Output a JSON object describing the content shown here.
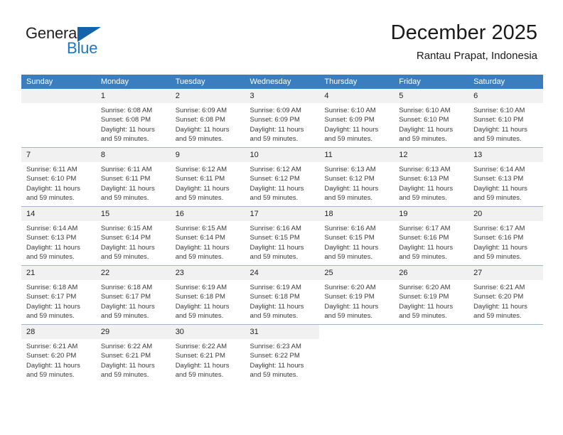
{
  "brand": {
    "name_part1": "General",
    "name_part2": "Blue",
    "accent_color": "#1b77c3",
    "triangle_color": "#1263ac",
    "triangle_icon": "triangle-right-icon"
  },
  "header": {
    "title": "December 2025",
    "subtitle": "Rantau Prapat, Indonesia"
  },
  "calendar": {
    "header_bg": "#3b7ebf",
    "daynum_bg": "#f1f1f1",
    "weekdays": [
      "Sunday",
      "Monday",
      "Tuesday",
      "Wednesday",
      "Thursday",
      "Friday",
      "Saturday"
    ],
    "weeks": [
      [
        {
          "day": "",
          "lines": []
        },
        {
          "day": "1",
          "lines": [
            "Sunrise: 6:08 AM",
            "Sunset: 6:08 PM",
            "Daylight: 11 hours",
            "and 59 minutes."
          ]
        },
        {
          "day": "2",
          "lines": [
            "Sunrise: 6:09 AM",
            "Sunset: 6:08 PM",
            "Daylight: 11 hours",
            "and 59 minutes."
          ]
        },
        {
          "day": "3",
          "lines": [
            "Sunrise: 6:09 AM",
            "Sunset: 6:09 PM",
            "Daylight: 11 hours",
            "and 59 minutes."
          ]
        },
        {
          "day": "4",
          "lines": [
            "Sunrise: 6:10 AM",
            "Sunset: 6:09 PM",
            "Daylight: 11 hours",
            "and 59 minutes."
          ]
        },
        {
          "day": "5",
          "lines": [
            "Sunrise: 6:10 AM",
            "Sunset: 6:10 PM",
            "Daylight: 11 hours",
            "and 59 minutes."
          ]
        },
        {
          "day": "6",
          "lines": [
            "Sunrise: 6:10 AM",
            "Sunset: 6:10 PM",
            "Daylight: 11 hours",
            "and 59 minutes."
          ]
        }
      ],
      [
        {
          "day": "7",
          "lines": [
            "Sunrise: 6:11 AM",
            "Sunset: 6:10 PM",
            "Daylight: 11 hours",
            "and 59 minutes."
          ]
        },
        {
          "day": "8",
          "lines": [
            "Sunrise: 6:11 AM",
            "Sunset: 6:11 PM",
            "Daylight: 11 hours",
            "and 59 minutes."
          ]
        },
        {
          "day": "9",
          "lines": [
            "Sunrise: 6:12 AM",
            "Sunset: 6:11 PM",
            "Daylight: 11 hours",
            "and 59 minutes."
          ]
        },
        {
          "day": "10",
          "lines": [
            "Sunrise: 6:12 AM",
            "Sunset: 6:12 PM",
            "Daylight: 11 hours",
            "and 59 minutes."
          ]
        },
        {
          "day": "11",
          "lines": [
            "Sunrise: 6:13 AM",
            "Sunset: 6:12 PM",
            "Daylight: 11 hours",
            "and 59 minutes."
          ]
        },
        {
          "day": "12",
          "lines": [
            "Sunrise: 6:13 AM",
            "Sunset: 6:13 PM",
            "Daylight: 11 hours",
            "and 59 minutes."
          ]
        },
        {
          "day": "13",
          "lines": [
            "Sunrise: 6:14 AM",
            "Sunset: 6:13 PM",
            "Daylight: 11 hours",
            "and 59 minutes."
          ]
        }
      ],
      [
        {
          "day": "14",
          "lines": [
            "Sunrise: 6:14 AM",
            "Sunset: 6:13 PM",
            "Daylight: 11 hours",
            "and 59 minutes."
          ]
        },
        {
          "day": "15",
          "lines": [
            "Sunrise: 6:15 AM",
            "Sunset: 6:14 PM",
            "Daylight: 11 hours",
            "and 59 minutes."
          ]
        },
        {
          "day": "16",
          "lines": [
            "Sunrise: 6:15 AM",
            "Sunset: 6:14 PM",
            "Daylight: 11 hours",
            "and 59 minutes."
          ]
        },
        {
          "day": "17",
          "lines": [
            "Sunrise: 6:16 AM",
            "Sunset: 6:15 PM",
            "Daylight: 11 hours",
            "and 59 minutes."
          ]
        },
        {
          "day": "18",
          "lines": [
            "Sunrise: 6:16 AM",
            "Sunset: 6:15 PM",
            "Daylight: 11 hours",
            "and 59 minutes."
          ]
        },
        {
          "day": "19",
          "lines": [
            "Sunrise: 6:17 AM",
            "Sunset: 6:16 PM",
            "Daylight: 11 hours",
            "and 59 minutes."
          ]
        },
        {
          "day": "20",
          "lines": [
            "Sunrise: 6:17 AM",
            "Sunset: 6:16 PM",
            "Daylight: 11 hours",
            "and 59 minutes."
          ]
        }
      ],
      [
        {
          "day": "21",
          "lines": [
            "Sunrise: 6:18 AM",
            "Sunset: 6:17 PM",
            "Daylight: 11 hours",
            "and 59 minutes."
          ]
        },
        {
          "day": "22",
          "lines": [
            "Sunrise: 6:18 AM",
            "Sunset: 6:17 PM",
            "Daylight: 11 hours",
            "and 59 minutes."
          ]
        },
        {
          "day": "23",
          "lines": [
            "Sunrise: 6:19 AM",
            "Sunset: 6:18 PM",
            "Daylight: 11 hours",
            "and 59 minutes."
          ]
        },
        {
          "day": "24",
          "lines": [
            "Sunrise: 6:19 AM",
            "Sunset: 6:18 PM",
            "Daylight: 11 hours",
            "and 59 minutes."
          ]
        },
        {
          "day": "25",
          "lines": [
            "Sunrise: 6:20 AM",
            "Sunset: 6:19 PM",
            "Daylight: 11 hours",
            "and 59 minutes."
          ]
        },
        {
          "day": "26",
          "lines": [
            "Sunrise: 6:20 AM",
            "Sunset: 6:19 PM",
            "Daylight: 11 hours",
            "and 59 minutes."
          ]
        },
        {
          "day": "27",
          "lines": [
            "Sunrise: 6:21 AM",
            "Sunset: 6:20 PM",
            "Daylight: 11 hours",
            "and 59 minutes."
          ]
        }
      ],
      [
        {
          "day": "28",
          "lines": [
            "Sunrise: 6:21 AM",
            "Sunset: 6:20 PM",
            "Daylight: 11 hours",
            "and 59 minutes."
          ]
        },
        {
          "day": "29",
          "lines": [
            "Sunrise: 6:22 AM",
            "Sunset: 6:21 PM",
            "Daylight: 11 hours",
            "and 59 minutes."
          ]
        },
        {
          "day": "30",
          "lines": [
            "Sunrise: 6:22 AM",
            "Sunset: 6:21 PM",
            "Daylight: 11 hours",
            "and 59 minutes."
          ]
        },
        {
          "day": "31",
          "lines": [
            "Sunrise: 6:23 AM",
            "Sunset: 6:22 PM",
            "Daylight: 11 hours",
            "and 59 minutes."
          ]
        },
        {
          "day": "",
          "lines": []
        },
        {
          "day": "",
          "lines": []
        },
        {
          "day": "",
          "lines": []
        }
      ]
    ]
  }
}
